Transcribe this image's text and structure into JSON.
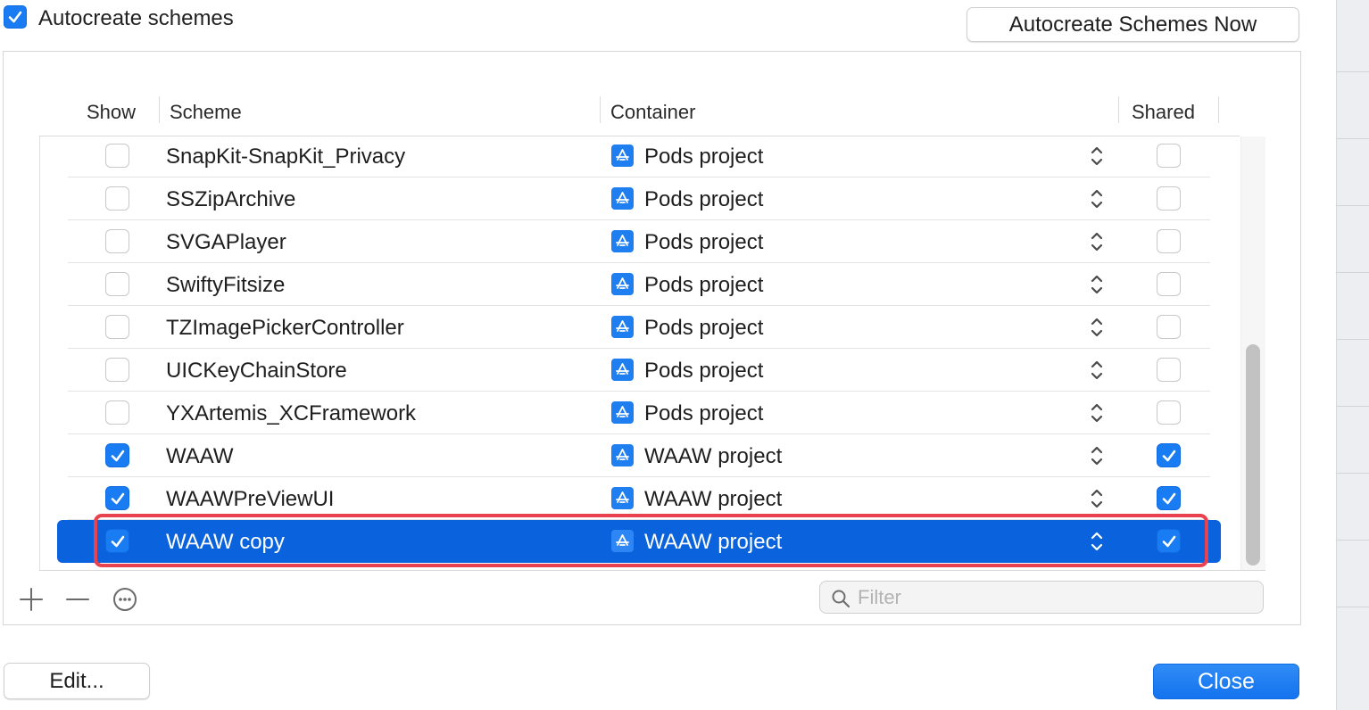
{
  "autocreate": {
    "label": "Autocreate schemes",
    "checked": true,
    "button_label": "Autocreate Schemes Now"
  },
  "table": {
    "columns": {
      "show": "Show",
      "scheme": "Scheme",
      "container": "Container",
      "shared": "Shared"
    },
    "rows": [
      {
        "show": false,
        "scheme": "SnapKit-SnapKit_Privacy",
        "container": "Pods project",
        "shared": false
      },
      {
        "show": false,
        "scheme": "SSZipArchive",
        "container": "Pods project",
        "shared": false
      },
      {
        "show": false,
        "scheme": "SVGAPlayer",
        "container": "Pods project",
        "shared": false
      },
      {
        "show": false,
        "scheme": "SwiftyFitsize",
        "container": "Pods project",
        "shared": false
      },
      {
        "show": false,
        "scheme": "TZImagePickerController",
        "container": "Pods project",
        "shared": false
      },
      {
        "show": false,
        "scheme": "UICKeyChainStore",
        "container": "Pods project",
        "shared": false
      },
      {
        "show": false,
        "scheme": "YXArtemis_XCFramework",
        "container": "Pods project",
        "shared": false
      },
      {
        "show": true,
        "scheme": "WAAW",
        "container": "WAAW project",
        "shared": true
      },
      {
        "show": true,
        "scheme": "WAAWPreViewUI",
        "container": "WAAW project",
        "shared": true
      },
      {
        "show": true,
        "scheme": "WAAW copy",
        "container": "WAAW project",
        "shared": true,
        "selected": true
      }
    ]
  },
  "toolbar": {
    "add_icon": "plus-icon",
    "remove_icon": "minus-icon",
    "more_icon": "ellipsis-circle-icon"
  },
  "filter": {
    "placeholder": "Filter",
    "value": ""
  },
  "footer": {
    "edit_label": "Edit...",
    "close_label": "Close"
  },
  "colors": {
    "accent": "#1a7cf2",
    "selection": "#0a63dd",
    "highlight_border": "#e8424e"
  }
}
